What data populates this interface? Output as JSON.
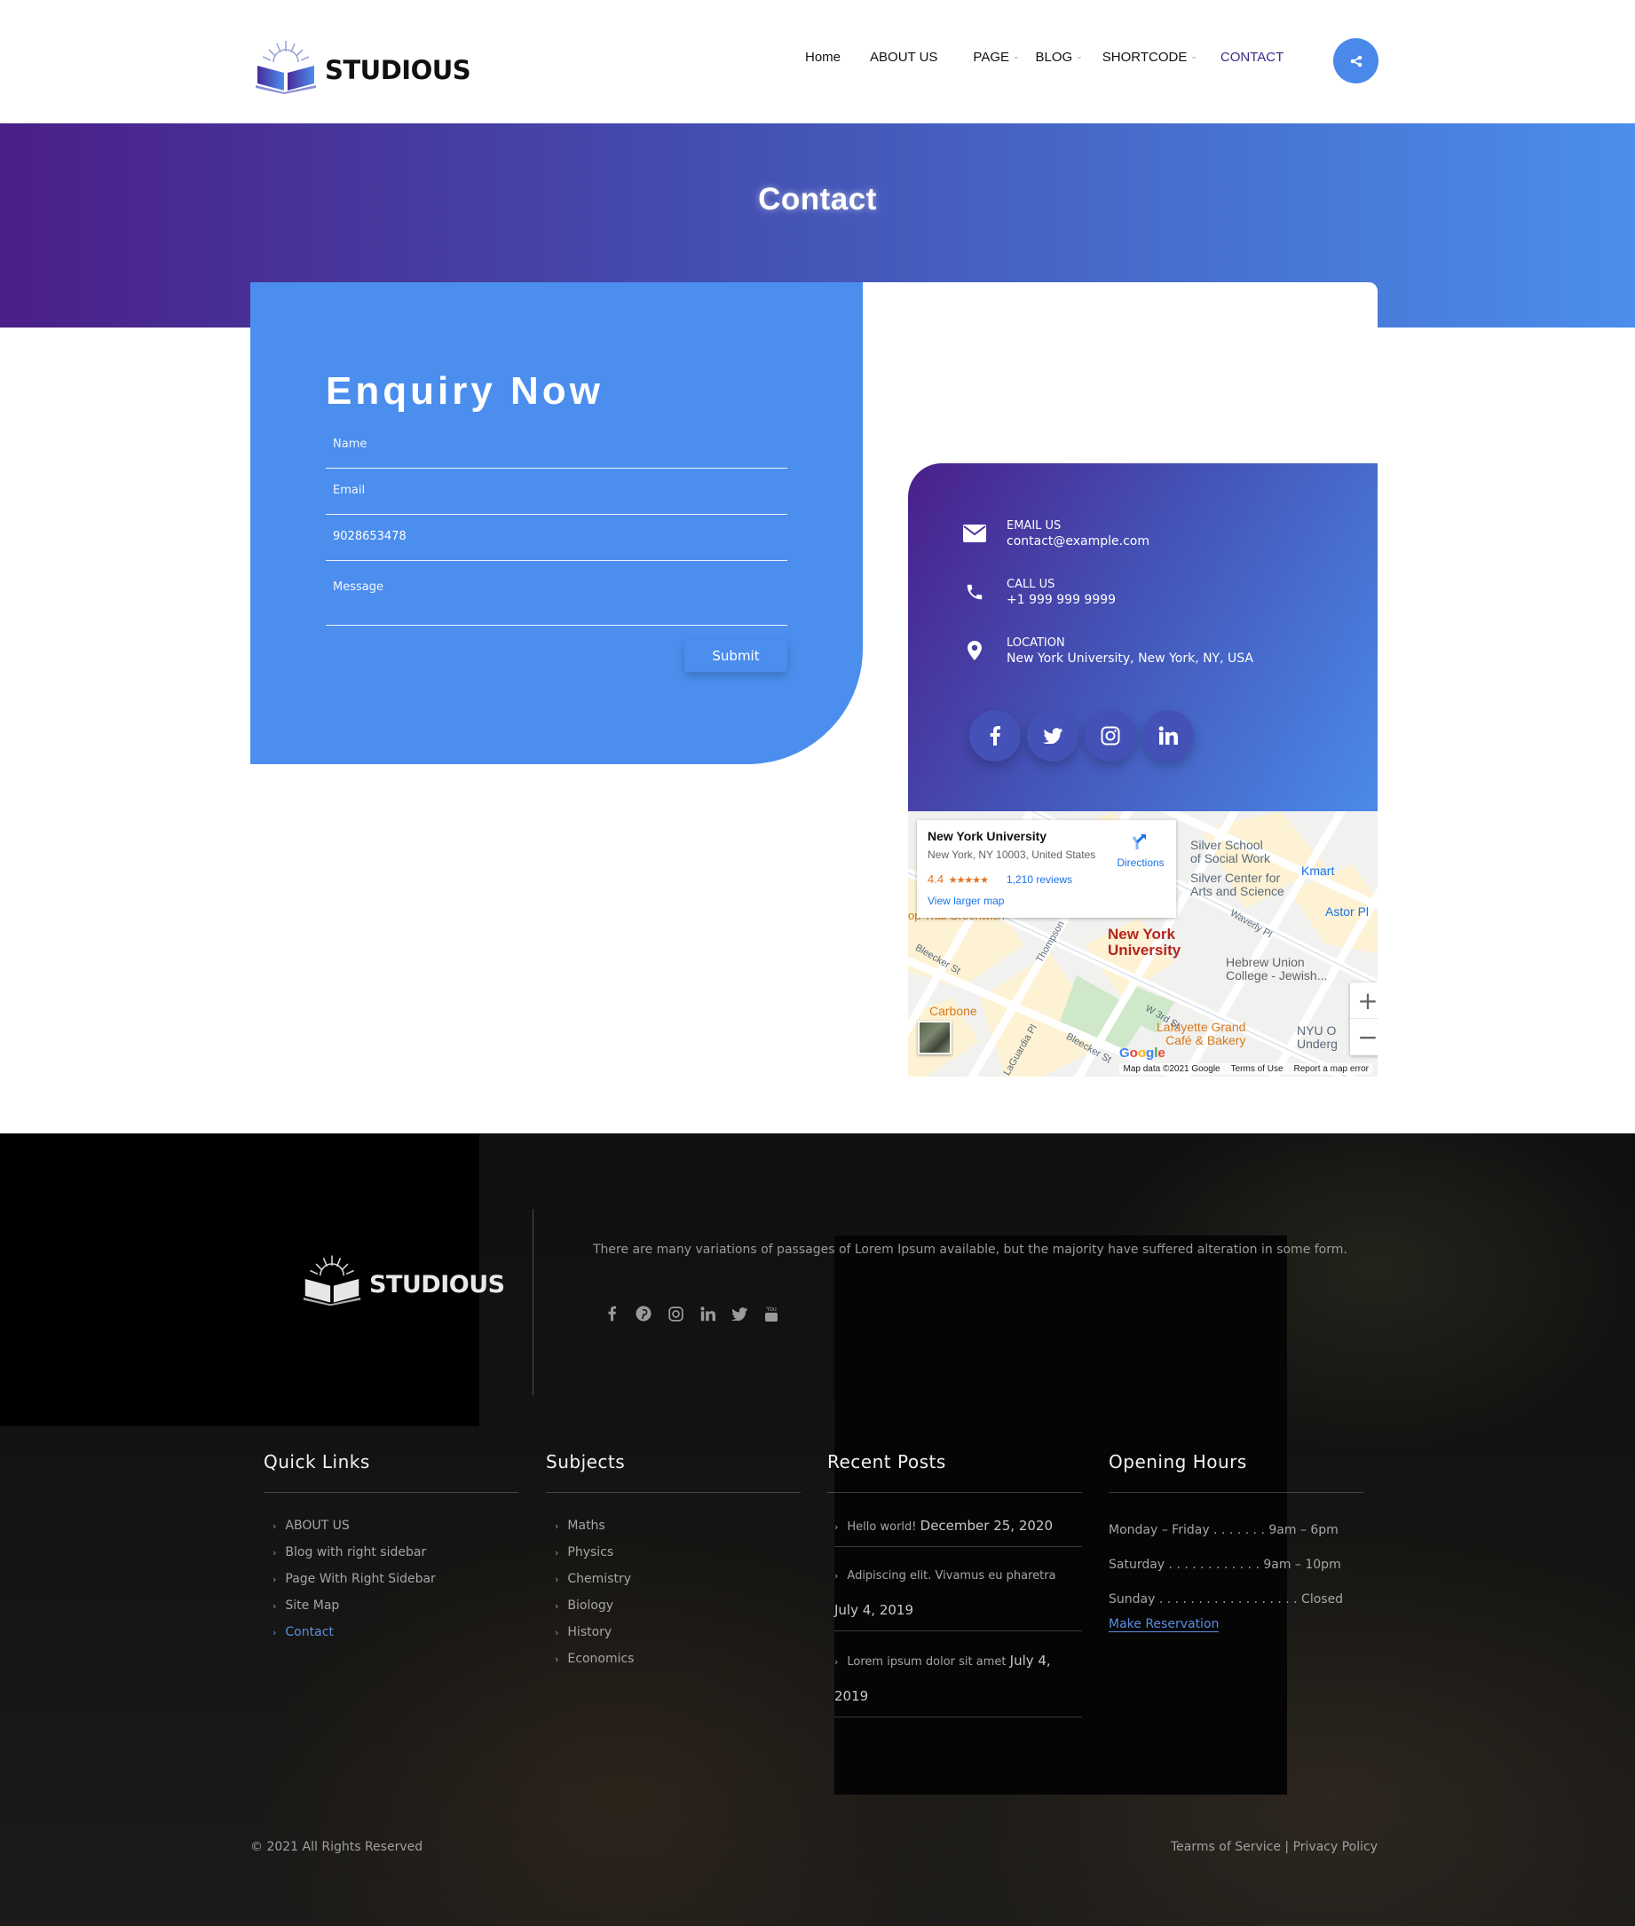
{
  "header": {
    "logo_text": "STUDIOUS",
    "nav": [
      {
        "label": "Home",
        "dropdown": false,
        "active": false
      },
      {
        "label": "ABOUT US",
        "dropdown": false,
        "active": false
      },
      {
        "label": "PAGE",
        "dropdown": true,
        "active": false
      },
      {
        "label": "BLOG",
        "dropdown": true,
        "active": false
      },
      {
        "label": "SHORTCODE",
        "dropdown": true,
        "active": false
      },
      {
        "label": "CONTACT",
        "dropdown": false,
        "active": true
      }
    ],
    "share_icon": "share-icon"
  },
  "banner": {
    "title": "Contact"
  },
  "enquiry": {
    "title": "Enquiry Now",
    "fields": {
      "name_placeholder": "Name",
      "email_placeholder": "Email",
      "phone_value": "9028653478",
      "message_placeholder": "Message"
    },
    "submit_label": "Submit"
  },
  "contact_info": {
    "items": [
      {
        "icon": "envelope-icon",
        "label": "EMAIL US",
        "value": "contact@example.com"
      },
      {
        "icon": "phone-icon",
        "label": "CALL US",
        "value": "+1 999 999 9999"
      },
      {
        "icon": "map-pin-icon",
        "label": "LOCATION",
        "value": "New York University, New York, NY, USA"
      }
    ],
    "socials": [
      "facebook-icon",
      "twitter-icon",
      "instagram-icon",
      "linkedin-icon"
    ]
  },
  "map": {
    "place_name": "New York University",
    "address": "New York, NY 10003, United States",
    "rating": "4.4",
    "stars": "★★★★★",
    "reviews": "1,210 reviews",
    "view_larger": "View larger map",
    "directions": "Directions",
    "labels": {
      "silver_school": "Silver School\nof Social Work",
      "silver_center": "Silver Center for\nArts and Science",
      "kmart": "Kmart",
      "astor": "Astor Pl",
      "nyu": "New York\nUniversity",
      "hebrew": "Hebrew Union\nCollege - Jewish...",
      "carbone": "Carbone",
      "lafayette": "Lafayette Grand\nCafé & Bakery",
      "nyu_o": "NYU O\nUnderg",
      "waverly": "Waverly Pl",
      "bleecker": "Bleecker St",
      "bleecker2": "Bleecker St",
      "thompson": "Thompson",
      "w3rd": "W 3rd St",
      "laguardia": "LaGuardia Pl",
      "thai": "op Thai Greenwich"
    },
    "zoom_in": "+",
    "zoom_out": "−",
    "google": "Google",
    "attribution": [
      "Map data ©2021 Google",
      "Terms of Use",
      "Report a map error"
    ]
  },
  "footer": {
    "logo_text": "STUDIOUS",
    "about": "There are many variations of passages of Lorem Ipsum available, but the majority have suffered alteration in some form.",
    "socials": [
      "facebook-icon",
      "pinterest-icon",
      "instagram-icon",
      "linkedin-icon",
      "twitter-icon",
      "youtube-icon"
    ],
    "quick_links": {
      "title": "Quick Links",
      "items": [
        "ABOUT US",
        "Blog with right sidebar",
        "Page With Right Sidebar",
        "Site Map",
        "Contact"
      ],
      "active_index": 4
    },
    "subjects": {
      "title": "Subjects",
      "items": [
        "Maths",
        "Physics",
        "Chemistry",
        "Biology",
        "History",
        "Economics"
      ]
    },
    "recent_posts": {
      "title": "Recent Posts",
      "items": [
        {
          "title": "Hello world!",
          "date": "December 25, 2020"
        },
        {
          "title": "Adipiscing elit. Vivamus eu pharetra",
          "date": "July 4, 2019"
        },
        {
          "title": "Lorem ipsum dolor sit amet",
          "date": "July 4, 2019"
        }
      ]
    },
    "opening_hours": {
      "title": "Opening Hours",
      "items": [
        "Monday – Friday . . . . . . . 9am – 6pm",
        "Saturday . . . . . . . . . . . . 9am – 10pm",
        "Sunday . . . . . . . . . . . . . . . . . . Closed"
      ],
      "reservation_label": "Make Reservation"
    },
    "copyright": "© 2021 All Rights Reserved",
    "terms": "Tearms of Service",
    "separator": "|",
    "privacy": "Privacy Policy"
  },
  "colors": {
    "accent_blue": "#4b8eee",
    "brand_purple": "#4a1f87",
    "active_nav": "#3b2a86",
    "link_blue": "#5b8ee0"
  }
}
